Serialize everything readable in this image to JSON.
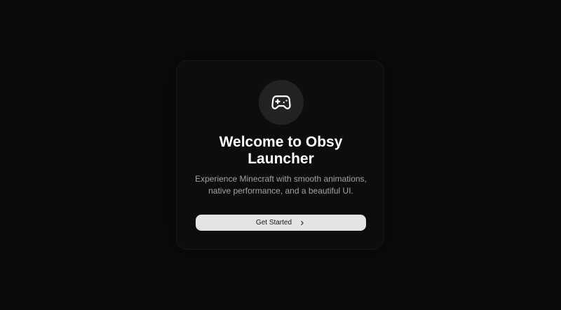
{
  "welcome": {
    "title": "Welcome to Obsy Launcher",
    "description": "Experience Minecraft with smooth animations, native performance, and a beautiful UI.",
    "cta_label": "Get Started",
    "icon": "gamepad-icon",
    "cta_icon": "chevron-right-icon"
  },
  "colors": {
    "background": "#0b0b0b",
    "card": "#0d0d0d",
    "icon_circle": "#222222",
    "button": "#e4e4e7",
    "title": "#ffffff",
    "description": "#a3a3a3"
  }
}
